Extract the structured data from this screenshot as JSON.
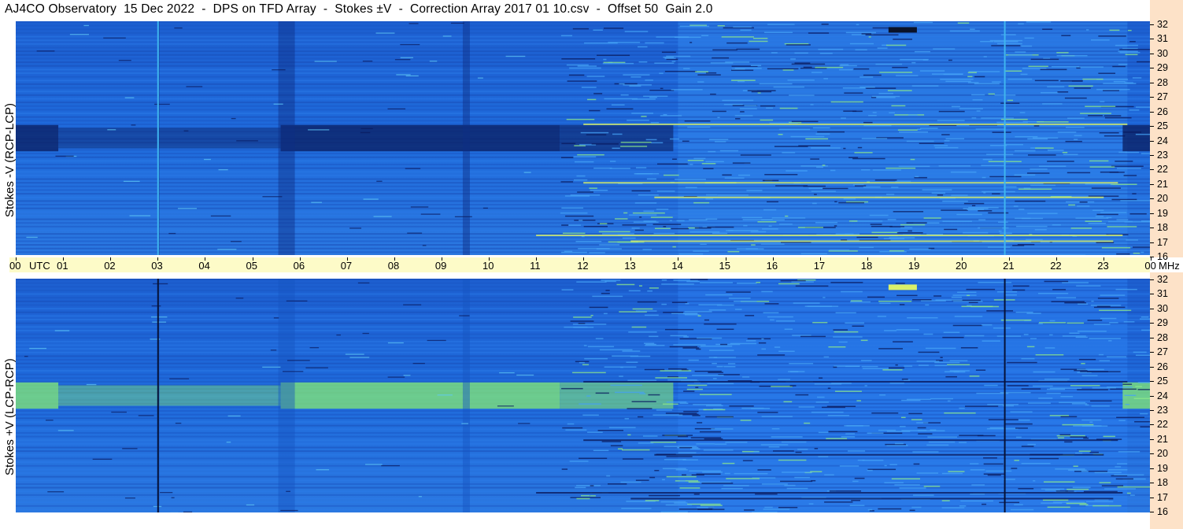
{
  "header": {
    "title": "AJ4CO Observatory  15 Dec 2022  -  DPS on TFD Array  -  Stokes ±V  -  Correction Array 2017 01 10.csv  -  Offset 50  Gain 2.0"
  },
  "chart_data": [
    {
      "type": "heatmap",
      "name": "top-panel",
      "ylabel": "Stokes -V (RCP-LCP)",
      "x_ticks": [
        "00",
        "01",
        "02",
        "03",
        "04",
        "05",
        "06",
        "07",
        "08",
        "09",
        "10",
        "11",
        "12",
        "13",
        "14",
        "15",
        "16",
        "17",
        "18",
        "19",
        "20",
        "21",
        "22",
        "23",
        "00"
      ],
      "x_unit": "UTC",
      "y_ticks": [
        "32",
        "31",
        "30",
        "29",
        "28",
        "27",
        "26",
        "25",
        "24",
        "23",
        "22",
        "21",
        "20",
        "19",
        "18",
        "17",
        "16"
      ],
      "y_unit": "MHz",
      "ylim": [
        16,
        32
      ],
      "xlim": [
        0,
        24
      ],
      "colors": {
        "low": "#0a1a5e",
        "mid": "#1e63d6",
        "high": "#8ee88a"
      }
    },
    {
      "type": "heatmap",
      "name": "bottom-panel",
      "ylabel": "Stokes +V (LCP-RCP)",
      "x_ticks": [
        "00",
        "01",
        "02",
        "03",
        "04",
        "05",
        "06",
        "07",
        "08",
        "09",
        "10",
        "11",
        "12",
        "13",
        "14",
        "15",
        "16",
        "17",
        "18",
        "19",
        "20",
        "21",
        "22",
        "23",
        "00"
      ],
      "x_unit": "UTC",
      "y_ticks": [
        "32",
        "31",
        "30",
        "29",
        "28",
        "27",
        "26",
        "25",
        "24",
        "23",
        "22",
        "21",
        "20",
        "19",
        "18",
        "17",
        "16"
      ],
      "y_unit": "MHz",
      "ylim": [
        16,
        32
      ],
      "xlim": [
        0,
        24
      ],
      "colors": {
        "low": "#0a1a5e",
        "mid": "#1e63d6",
        "high": "#8ee88a"
      }
    }
  ],
  "axis": {
    "utc_label": "UTC",
    "mhz_label": "MHz"
  }
}
